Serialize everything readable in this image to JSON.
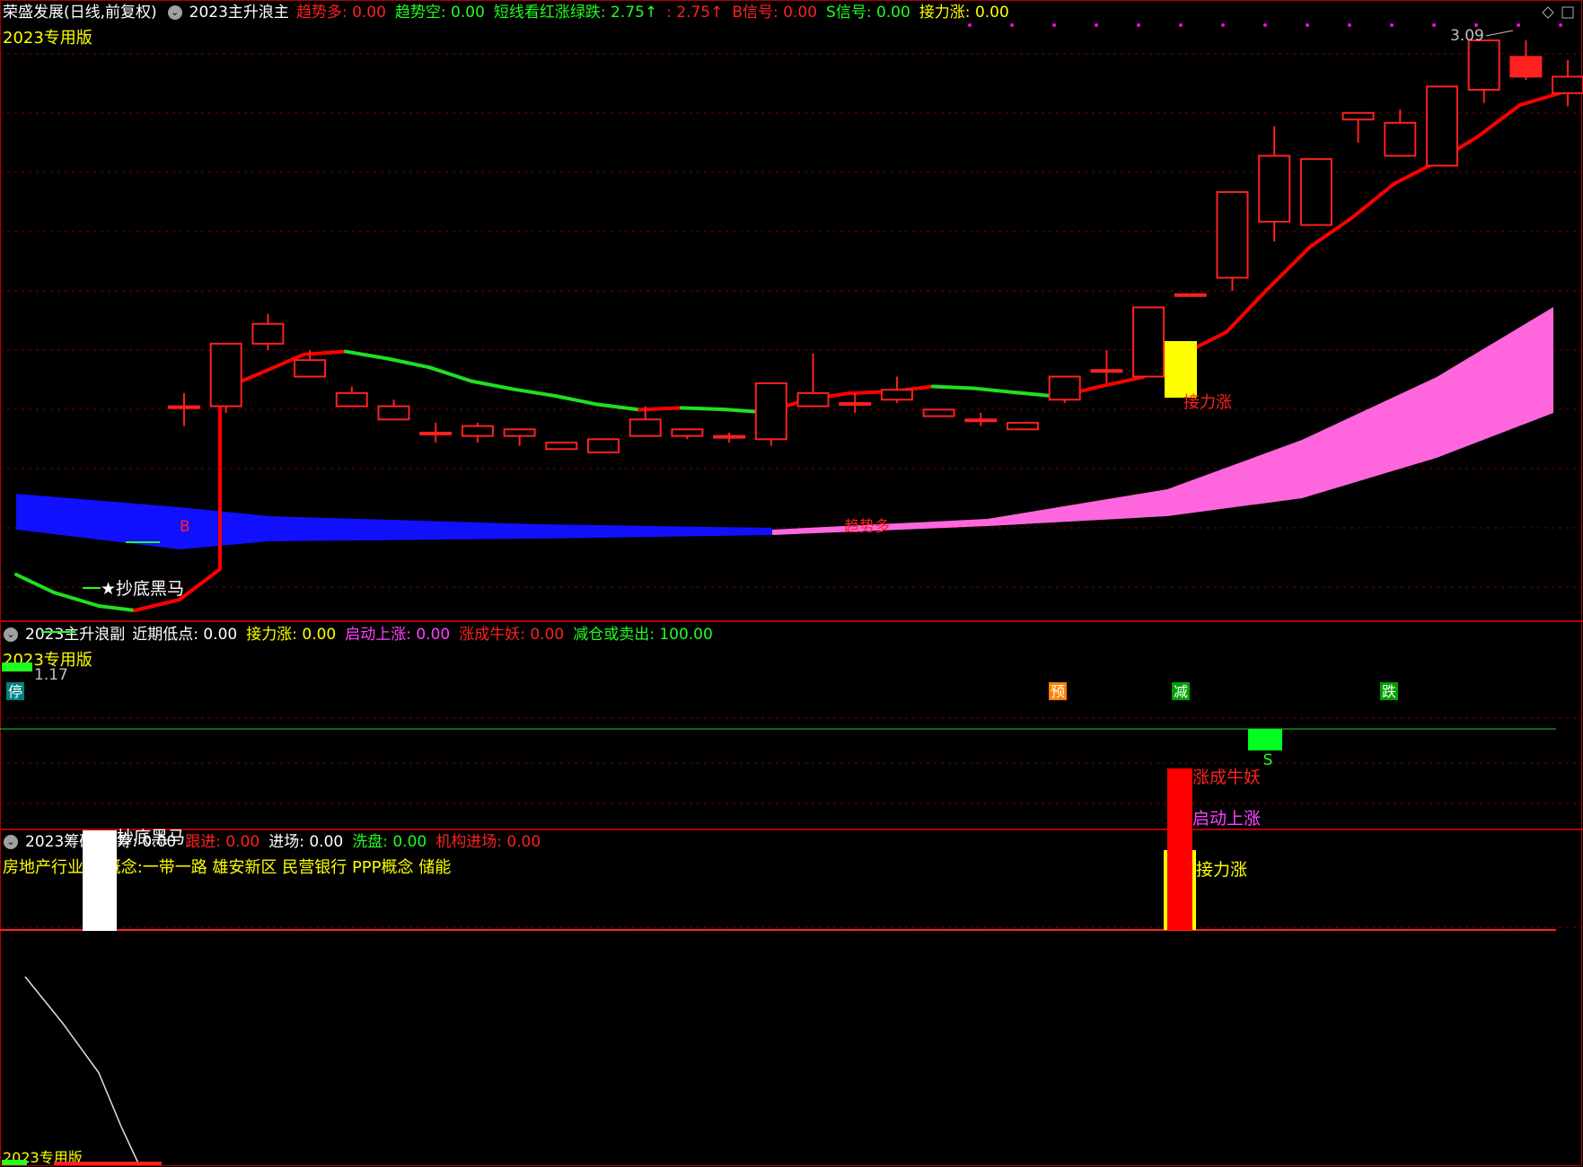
{
  "main_header": {
    "stock": "荣盛发展(日线,前复权)",
    "indicator": "2023主升浪主",
    "items": [
      {
        "label": "趋势多: 0.00",
        "color": "#ff2020"
      },
      {
        "label": "趋势空: 0.00",
        "color": "#20ff20"
      },
      {
        "label": "短线看红涨绿跌: 2.75↑",
        "color": "#20ff20"
      },
      {
        "label": ": 2.75↑",
        "color": "#ff2020"
      },
      {
        "label": "B信号: 0.00",
        "color": "#ff2020"
      },
      {
        "label": "S信号: 0.00",
        "color": "#20ff20"
      },
      {
        "label": "接力涨: 0.00",
        "color": "#ffff00"
      }
    ],
    "edition": "2023专用版"
  },
  "main_chart": {
    "high_label": "3.09",
    "low_label": "1.17",
    "annotations": {
      "bottom_fish": "★抄底黑马",
      "relay": "接力涨",
      "trend": "趋势多",
      "b_signal": "B"
    },
    "bottom_markers": [
      {
        "label": "停",
        "bg": "#008080",
        "color": "#ffffff"
      },
      {
        "label": "预",
        "bg": "#ff8000",
        "color": "#ffffff"
      },
      {
        "label": "减",
        "bg": "#00a000",
        "color": "#ffffff"
      },
      {
        "label": "跌",
        "bg": "#00a000",
        "color": "#ffffff"
      }
    ]
  },
  "sub1": {
    "title": "2023主升浪副",
    "items": [
      {
        "label": "近期低点: 0.00",
        "color": "#ffffff"
      },
      {
        "label": "接力涨: 0.00",
        "color": "#ffff00"
      },
      {
        "label": "启动上涨: 0.00",
        "color": "#ff40ff"
      },
      {
        "label": "涨成牛妖: 0.00",
        "color": "#ff2020"
      },
      {
        "label": "减仓或卖出: 100.00",
        "color": "#20ff20"
      }
    ],
    "edition": "2023专用版",
    "labels": {
      "bottom_fish": "抄底黑马",
      "bull": "涨成牛妖",
      "start": "启动上涨",
      "relay": "接力涨",
      "s": "S"
    }
  },
  "sub2": {
    "title": "2023筹码",
    "items": [
      {
        "label": "吸筹: 0.00",
        "color": "#ffffff"
      },
      {
        "label": "跟进: 0.00",
        "color": "#ff2020"
      },
      {
        "label": "进场: 0.00",
        "color": "#ffffff"
      },
      {
        "label": "洗盘: 0.00",
        "color": "#20ff20"
      },
      {
        "label": "机构进场: 0.00",
        "color": "#ff2020"
      }
    ],
    "concept": "房地产行业， 概念:一带一路 雄安新区 民营银行 PPP概念 储能",
    "edition": "2023专用版"
  },
  "candles": [
    {
      "o": 1.98,
      "c": 1.98,
      "h": 2.02,
      "l": 1.92
    },
    {
      "o": 1.98,
      "c": 2.17,
      "h": 2.17,
      "l": 1.96
    },
    {
      "o": 2.17,
      "c": 2.23,
      "h": 2.26,
      "l": 2.15
    },
    {
      "o": 2.07,
      "c": 2.12,
      "h": 2.15,
      "l": 2.07
    },
    {
      "o": 1.98,
      "c": 2.02,
      "h": 2.04,
      "l": 1.98
    },
    {
      "o": 1.94,
      "c": 1.98,
      "h": 2.0,
      "l": 1.94
    },
    {
      "o": 1.9,
      "c": 1.9,
      "h": 1.93,
      "l": 1.87
    },
    {
      "o": 1.89,
      "c": 1.92,
      "h": 1.93,
      "l": 1.87
    },
    {
      "o": 1.89,
      "c": 1.91,
      "h": 1.91,
      "l": 1.86
    },
    {
      "o": 1.85,
      "c": 1.87,
      "h": 1.87,
      "l": 1.85
    },
    {
      "o": 1.84,
      "c": 1.88,
      "h": 1.88,
      "l": 1.84
    },
    {
      "o": 1.89,
      "c": 1.94,
      "h": 1.98,
      "l": 1.89
    },
    {
      "o": 1.89,
      "c": 1.91,
      "h": 1.91,
      "l": 1.88
    },
    {
      "o": 1.89,
      "c": 1.89,
      "h": 1.9,
      "l": 1.87
    },
    {
      "o": 1.88,
      "c": 2.05,
      "h": 2.05,
      "l": 1.86
    },
    {
      "o": 1.98,
      "c": 2.02,
      "h": 2.14,
      "l": 1.98
    },
    {
      "o": 1.99,
      "c": 1.99,
      "h": 2.02,
      "l": 1.96
    },
    {
      "o": 2.0,
      "c": 2.03,
      "h": 2.07,
      "l": 1.99
    },
    {
      "o": 1.95,
      "c": 1.97,
      "h": 1.97,
      "l": 1.95
    },
    {
      "o": 1.94,
      "c": 1.94,
      "h": 1.96,
      "l": 1.92
    },
    {
      "o": 1.91,
      "c": 1.93,
      "h": 1.93,
      "l": 1.91
    },
    {
      "o": 2.0,
      "c": 2.07,
      "h": 2.07,
      "l": 1.99
    },
    {
      "o": 2.09,
      "c": 2.09,
      "h": 2.15,
      "l": 2.05
    },
    {
      "o": 2.07,
      "c": 2.28,
      "h": 2.28,
      "l": 2.07
    },
    {
      "o": 2.32,
      "c": 2.32,
      "h": 2.32,
      "l": 2.32
    },
    {
      "o": 2.37,
      "c": 2.63,
      "h": 2.63,
      "l": 2.33
    },
    {
      "o": 2.54,
      "c": 2.74,
      "h": 2.83,
      "l": 2.48
    },
    {
      "o": 2.53,
      "c": 2.73,
      "h": 2.73,
      "l": 2.53
    },
    {
      "o": 2.85,
      "c": 2.87,
      "h": 2.87,
      "l": 2.78
    },
    {
      "o": 2.74,
      "c": 2.84,
      "h": 2.88,
      "l": 2.74
    },
    {
      "o": 2.71,
      "c": 2.95,
      "h": 2.95,
      "l": 2.71
    },
    {
      "o": 2.94,
      "c": 3.09,
      "h": 3.09,
      "l": 2.9
    },
    {
      "o": 3.04,
      "c": 2.98,
      "h": 3.09,
      "l": 2.97
    },
    {
      "o": 2.93,
      "c": 2.98,
      "h": 3.03,
      "l": 2.89
    }
  ],
  "colors": {
    "up": "#ff2020",
    "down_fill": "#000000",
    "trend_up": "#ff0000",
    "trend_down": "#20e020",
    "blue_band": "#1010ff",
    "pink_band": "#ff66dd",
    "grid": "#7a0000",
    "border": "#b00000",
    "relay_bar": "#ffff00",
    "white_bar": "#ffffff",
    "s_bar": "#00ff20"
  }
}
